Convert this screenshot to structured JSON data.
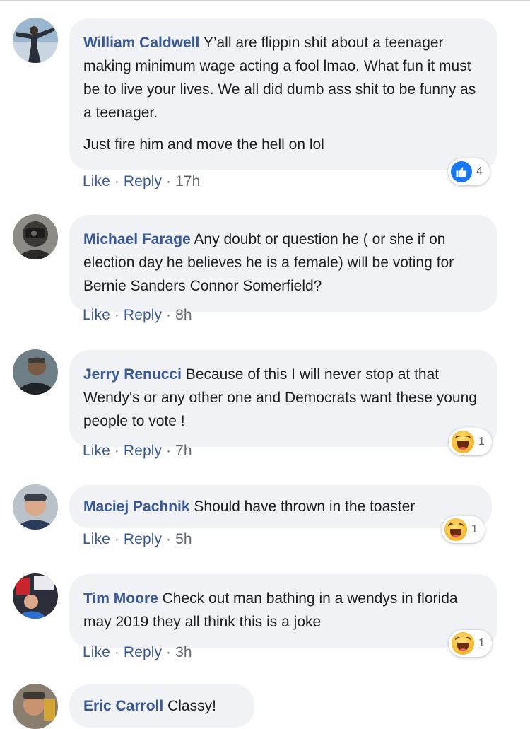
{
  "comments": [
    {
      "author": "William Caldwell",
      "text": "Y’all are flippin shit about a teenager making minimum wage acting a fool lmao. What fun it must be to live your lives. We all did dumb ass shit to be funny as a teenager.",
      "text2": "Just fire him and move the hell on lol",
      "like_label": "Like",
      "reply_label": "Reply",
      "time": "17h",
      "reaction": {
        "icon": "like-icon",
        "count": "4"
      }
    },
    {
      "author": "Michael Farage",
      "text": "Any doubt or question he ( or she if on election day he believes he is a female) will be voting for Bernie Sanders Connor Somerfield?",
      "like_label": "Like",
      "reply_label": "Reply",
      "time": "8h"
    },
    {
      "author": "Jerry Renucci",
      "text": "Because of this I will never stop at that Wendy's or any other one and Democrats want these young people to vote !",
      "like_label": "Like",
      "reply_label": "Reply",
      "time": "7h",
      "reaction": {
        "icon": "haha-icon",
        "count": "1"
      }
    },
    {
      "author": "Maciej Pachnik",
      "text": "Should have thrown in the toaster",
      "like_label": "Like",
      "reply_label": "Reply",
      "time": "5h",
      "reaction": {
        "icon": "haha-icon",
        "count": "1"
      }
    },
    {
      "author": "Tim Moore",
      "text": "Check out man bathing in a wendys in florida may 2019 they all think this is a joke",
      "like_label": "Like",
      "reply_label": "Reply",
      "time": "3h",
      "reaction": {
        "icon": "haha-icon",
        "count": "1"
      }
    },
    {
      "author": "Eric Carroll",
      "text": "Classy!"
    }
  ],
  "separator": " · ",
  "colors": {
    "link": "#385898",
    "bubble": "#f0f2f5",
    "meta": "#606770",
    "like_blue": "#1877f2"
  }
}
